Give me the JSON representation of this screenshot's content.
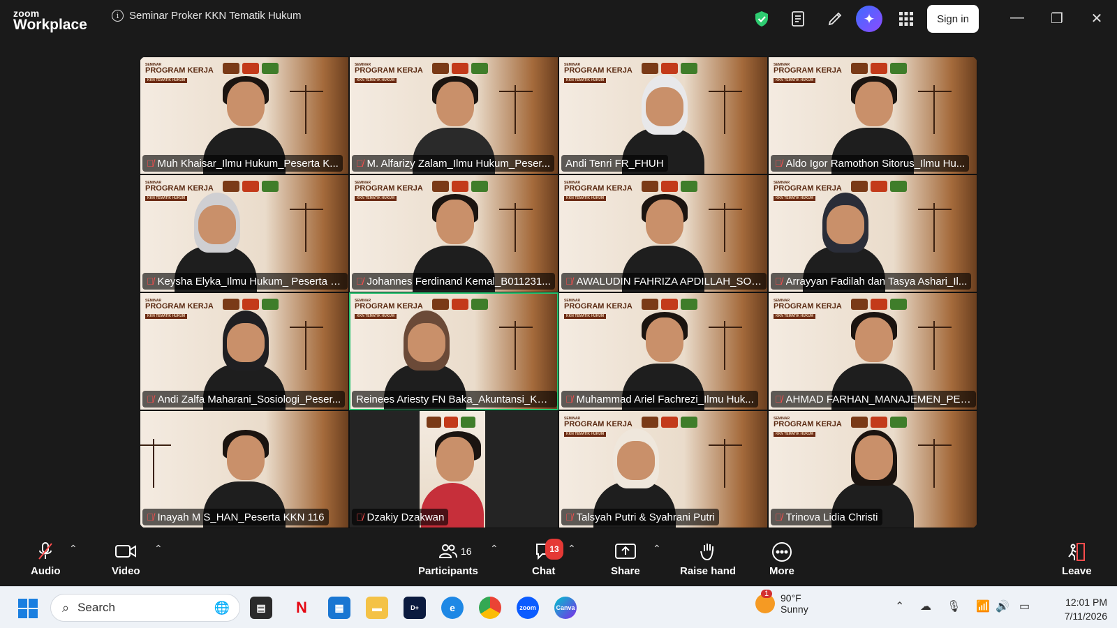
{
  "app": {
    "brand_top": "zoom",
    "brand_bottom": "Workplace",
    "meeting_title": "Seminar Proker KKN Tematik Hukum",
    "signin_label": "Sign in"
  },
  "banner": {
    "small": "SEMINAR",
    "title": "PROGRAM KERJA",
    "tag": "KKN TEMATIK HUKUM"
  },
  "participants": [
    {
      "name": "Muh Khaisar_Ilmu Hukum_Peserta K...",
      "muted": true
    },
    {
      "name": "M. Alfarizy Zalam_Ilmu Hukum_Peser...",
      "muted": true
    },
    {
      "name": "Andi Tenri FR_FHUH",
      "muted": false
    },
    {
      "name": "Aldo Igor Ramothon Sitorus_Ilmu Hu...",
      "muted": true
    },
    {
      "name": "Keysha Elyka_Ilmu Hukum_ Peserta K...",
      "muted": true
    },
    {
      "name": "Johannes Ferdinand Kemal_B011231...",
      "muted": true
    },
    {
      "name": "AWALUDIN FAHRIZA APDILLAH_SOSI...",
      "muted": true
    },
    {
      "name": "Arrayyan Fadilah dan Tasya Ashari_Il...",
      "muted": true
    },
    {
      "name": "Andi Zalfa Maharani_Sosiologi_Peser...",
      "muted": true
    },
    {
      "name": "Reinees Ariesty FN Baka_Akuntansi_KKN...",
      "muted": false,
      "active_speaker": true
    },
    {
      "name": "Muhammad Ariel Fachrezi_Ilmu Huk...",
      "muted": true
    },
    {
      "name": "AHMAD FARHAN_MANAJEMEN_PES...",
      "muted": true
    },
    {
      "name": "Inayah M S_HAN_Peserta KKN 116",
      "muted": true
    },
    {
      "name": "Dzakiy Dzakwan",
      "muted": true
    },
    {
      "name": "Talsyah Putri & Syahrani Putri",
      "muted": true
    },
    {
      "name": "Trinova Lidia Christi",
      "muted": true
    }
  ],
  "toolbar": {
    "audio": "Audio",
    "video": "Video",
    "participants": "Participants",
    "participants_count": "16",
    "chat": "Chat",
    "chat_badge": "13",
    "share": "Share",
    "raise_hand": "Raise hand",
    "more": "More",
    "leave": "Leave"
  },
  "taskbar": {
    "search_placeholder": "Search",
    "weather_temp": "90°F",
    "weather_desc": "Sunny",
    "weather_badge": "1",
    "time": "12:01 PM",
    "date": "7/11/2026"
  },
  "colors": {
    "active_speaker": "#25c16f",
    "muted_icon": "#ff4d4d",
    "chat_badge": "#e53935",
    "ai_button": "#5b5cff"
  },
  "icons": {
    "info": "info-icon",
    "shield": "shield-check-icon",
    "notes": "notes-icon",
    "whiteboard": "pen-icon",
    "ai": "sparkle-icon",
    "apps": "grid-icon"
  }
}
